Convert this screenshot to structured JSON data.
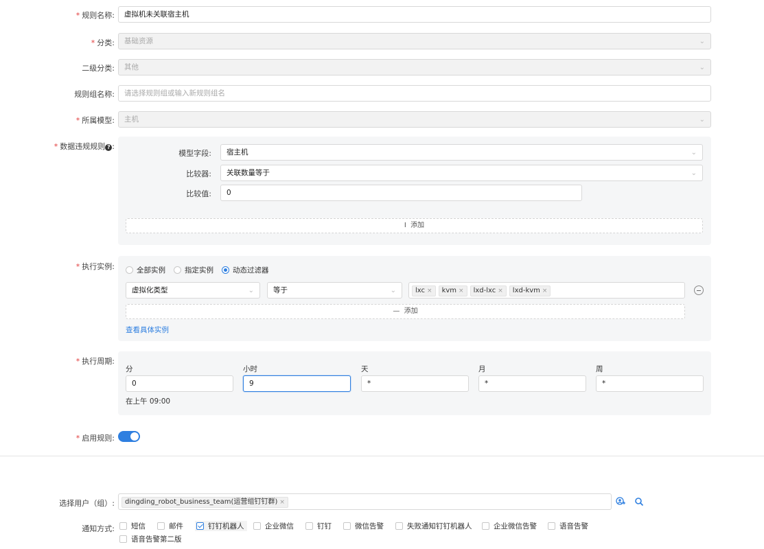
{
  "form": {
    "rule_name": {
      "label": "规则名称:",
      "value": "虚拟机未关联宿主机"
    },
    "category": {
      "label": "分类:",
      "value": "基础资源"
    },
    "sub_category": {
      "label": "二级分类:",
      "value": "其他"
    },
    "rule_group": {
      "label": "规则组名称:",
      "placeholder": "请选择规则组或输入新规则组名"
    },
    "model": {
      "label": "所属模型:",
      "value": "主机"
    },
    "violation": {
      "label": "数据违规规则",
      "colon": ":",
      "field_label": "模型字段:",
      "field_value": "宿主机",
      "comparator_label": "比较器:",
      "comparator_value": "关联数量等于",
      "compare_value_label": "比较值:",
      "compare_value": "0",
      "add_label": "添加"
    },
    "instances": {
      "label": "执行实例:",
      "options": [
        "全部实例",
        "指定实例",
        "动态过滤器"
      ],
      "selected": "动态过滤器",
      "filter_field": "虚拟化类型",
      "filter_op": "等于",
      "tags": [
        "lxc",
        "kvm",
        "lxd-lxc",
        "lxd-kvm"
      ],
      "add_label": "添加",
      "view_link": "查看具体实例"
    },
    "schedule": {
      "label": "执行周期:",
      "fields": [
        {
          "label": "分",
          "value": "0"
        },
        {
          "label": "小时",
          "value": "9"
        },
        {
          "label": "天",
          "value": "*"
        },
        {
          "label": "月",
          "value": "*"
        },
        {
          "label": "周",
          "value": "*"
        }
      ],
      "description": "在上午 09:00"
    },
    "enable": {
      "label": "启用规则:",
      "enabled": true
    }
  },
  "notify": {
    "users_label": "选择用户（组）:",
    "user_tag": "dingding_robot_business_team(运营组钉钉群)",
    "methods_label": "通知方式:",
    "methods": [
      {
        "label": "短信",
        "checked": false
      },
      {
        "label": "邮件",
        "checked": false
      },
      {
        "label": "钉钉机器人",
        "checked": true
      },
      {
        "label": "企业微信",
        "checked": false
      },
      {
        "label": "钉钉",
        "checked": false
      },
      {
        "label": "微信告警",
        "checked": false
      },
      {
        "label": "失败通知钉钉机器人",
        "checked": false
      },
      {
        "label": "企业微信告警",
        "checked": false
      },
      {
        "label": "语音告警",
        "checked": false
      },
      {
        "label": "语音告警第二版",
        "checked": false
      }
    ]
  },
  "icons": {
    "chevron": "chevron-down-icon",
    "help": "question-circle-icon",
    "remove": "minus-circle-icon",
    "user_add": "user-add-icon",
    "search": "search-icon"
  },
  "colors": {
    "accent": "#2e7fe0",
    "required": "#e23b3b"
  }
}
